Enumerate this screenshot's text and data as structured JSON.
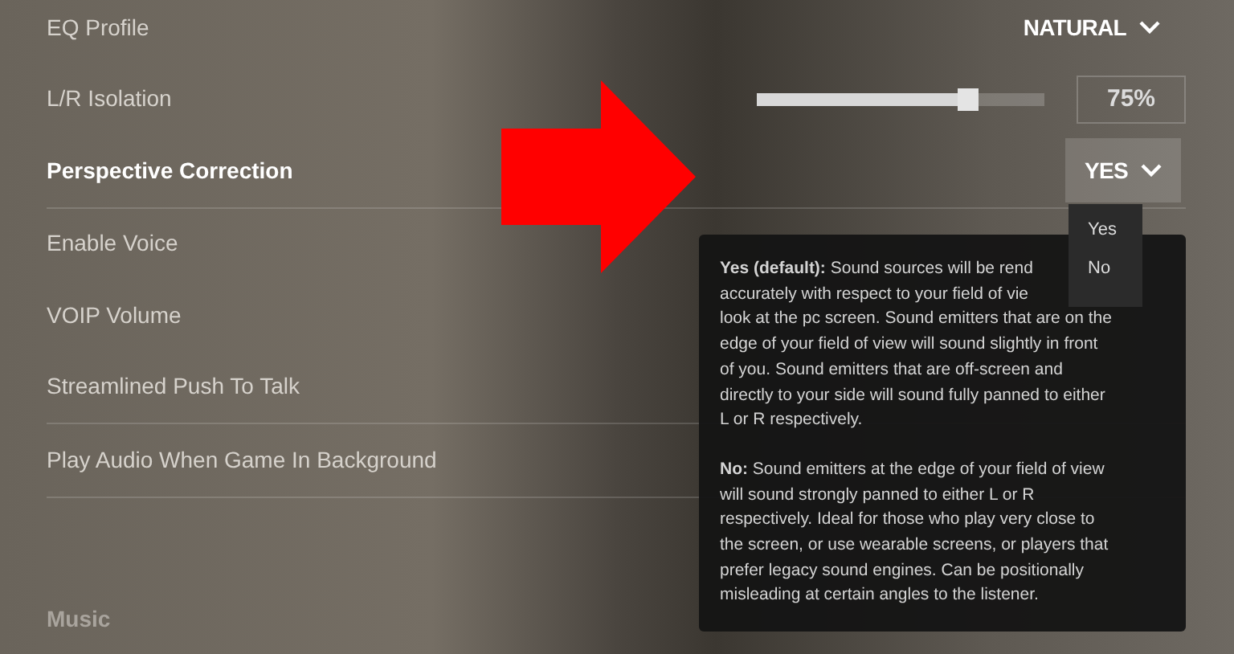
{
  "groups": [
    {
      "settings": [
        {
          "label": "EQ Profile",
          "kind": "dropdown",
          "value": "NATURAL",
          "highlighted": false,
          "open": false
        },
        {
          "label": "L/R Isolation",
          "kind": "slider",
          "level": 0.73,
          "reading": "75%",
          "highlighted": false
        },
        {
          "label": "Perspective Correction",
          "kind": "dropdown",
          "value": "YES",
          "highlighted": true,
          "open": true
        }
      ]
    },
    {
      "settings": [
        {
          "label": "Enable Voice",
          "kind": "plain",
          "highlighted": false
        },
        {
          "label": "VOIP Volume",
          "kind": "plain",
          "highlighted": false
        },
        {
          "label": "Streamlined Push To Talk",
          "kind": "plain",
          "highlighted": false
        }
      ]
    },
    {
      "settings": [
        {
          "label": "Play Audio When Game In Background",
          "kind": "plain",
          "highlighted": false
        }
      ]
    }
  ],
  "section_heading": "Music",
  "dropdown_menu": {
    "options": [
      {
        "label": "Yes"
      },
      {
        "label": "No"
      }
    ]
  },
  "tooltip": {
    "paragraphs": [
      {
        "lines": [
          "**Yes (default):** Sound sources will be rend",
          "accurately with respect to your field of vie",
          "look at the pc screen. Sound emitters that are on the",
          "edge of your field of view will sound slightly in front",
          "of you. Sound emitters that are off-screen and",
          "directly to your side will sound fully panned to either",
          "L or R respectively."
        ]
      },
      {
        "lines": [
          "**No:** Sound emitters at the edge of your field of view",
          "will sound strongly panned to either L or R",
          "respectively. Ideal for those who play very close to",
          "the screen, or use wearable screens, or players that",
          "prefer legacy sound engines. Can be positionally",
          "misleading at certain angles to the listener."
        ]
      }
    ]
  }
}
